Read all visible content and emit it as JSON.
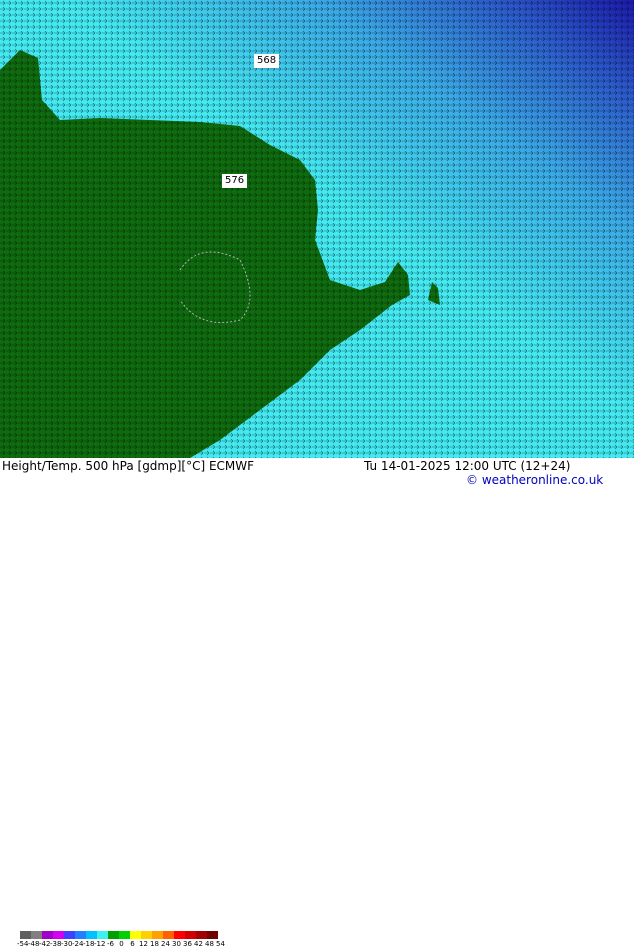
{
  "map": {
    "contour_labels": [
      "568",
      "576"
    ],
    "colors": {
      "cold_deep": "#1a1aa8",
      "cold_mid": "#2f6bd8",
      "cyan": "#43e8f0",
      "green": "#0f6b0f"
    }
  },
  "footer": {
    "title": "Height/Temp. 500 hPa [gdmp][°C] ECMWF",
    "datetime": "Tu 14-01-2025 12:00 UTC (12+24)",
    "credit": "© weatheronline.co.uk",
    "colorbar_ticks": [
      "-54",
      "-48",
      "-42",
      "-38",
      "-30",
      "-24",
      "-18",
      "-12",
      "-6",
      "0",
      "6",
      "12",
      "18",
      "24",
      "30",
      "36",
      "42",
      "48",
      "54"
    ],
    "colorbar_colors": [
      "#606060",
      "#808080",
      "#a000c8",
      "#d000f0",
      "#4040ff",
      "#2080ff",
      "#00c0ff",
      "#40f0f0",
      "#00a000",
      "#00d000",
      "#ffff00",
      "#ffd000",
      "#ffa000",
      "#ff6000",
      "#ff0000",
      "#d00000",
      "#a00000",
      "#700000"
    ]
  }
}
